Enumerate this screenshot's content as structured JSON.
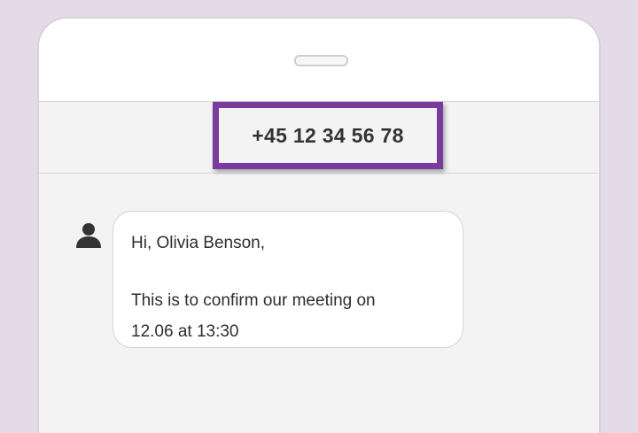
{
  "header": {
    "phone_number": "+45 12 34 56 78"
  },
  "message": {
    "sender_icon": "person-icon",
    "greeting": "Hi, Olivia Benson,",
    "body_line1": "This is to confirm our meeting on",
    "body_line2": "12.06 at 13:30"
  },
  "colors": {
    "background": "#e4dbe9",
    "highlight": "#7a3b9f",
    "bubble": "#ffffff"
  }
}
